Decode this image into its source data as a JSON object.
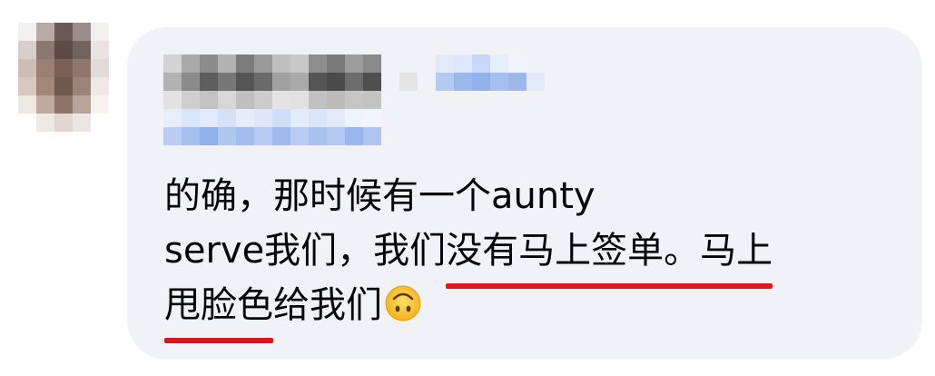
{
  "comment": {
    "line1": "的确，那时候有一个aunty",
    "line2_plain": "serve我们，我们",
    "line2_underlined": "没有马上签单。马上",
    "line3_underlined": "甩脸色",
    "line3_plain": "给我们",
    "emoji_name": "upside-down-face-icon"
  },
  "colors": {
    "bubble": "#f0f2f5",
    "text": "#050505",
    "underline": "#e0141c",
    "tag_blue": "#9bb8ec"
  }
}
